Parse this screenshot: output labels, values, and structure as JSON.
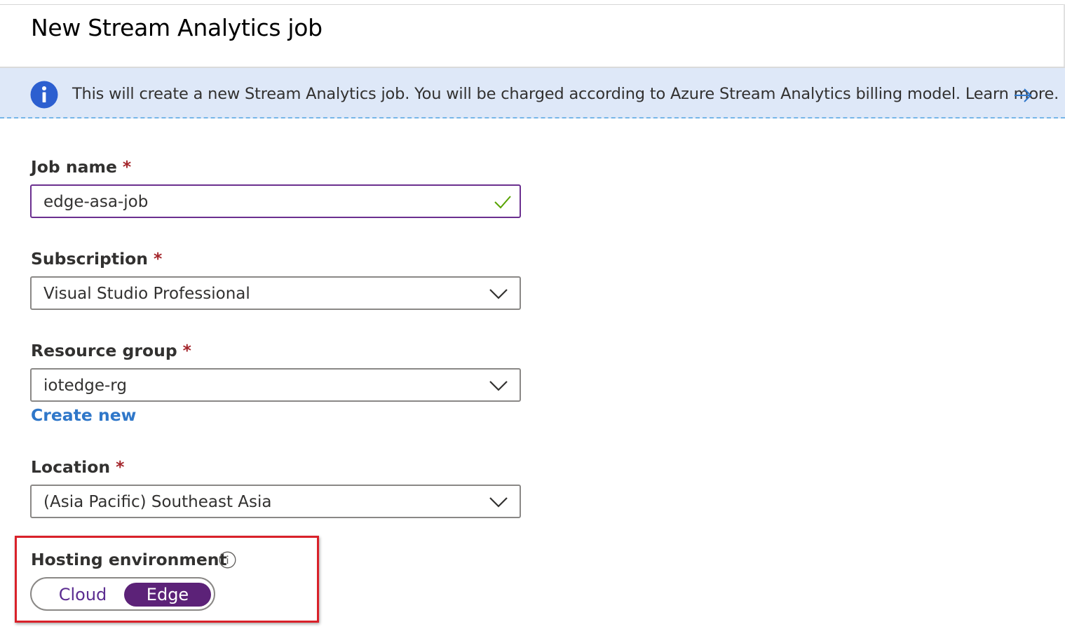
{
  "page": {
    "title": "New Stream Analytics job"
  },
  "banner": {
    "text": "This will create a new Stream Analytics job. You will be charged according to Azure Stream Analytics billing model. Learn more.",
    "icon": "info-icon",
    "link_icon": "arrow-right-icon"
  },
  "form": {
    "required_marker": "*",
    "job_name": {
      "label": "Job name",
      "value": "edge-asa-job",
      "valid": true
    },
    "subscription": {
      "label": "Subscription",
      "value": "Visual Studio Professional"
    },
    "resource_group": {
      "label": "Resource group",
      "value": "iotedge-rg",
      "create_new_label": "Create new"
    },
    "location": {
      "label": "Location",
      "value": "(Asia Pacific) Southeast Asia"
    },
    "hosting_environment": {
      "label": "Hosting environment",
      "options": [
        "Cloud",
        "Edge"
      ],
      "selected": "Edge"
    }
  },
  "colors": {
    "accent_purple": "#5c2278",
    "link_blue": "#2f77c9",
    "required_red": "#a4262c",
    "highlight_red": "#d9212a",
    "banner_bg": "#dee8f8",
    "valid_green": "#57a300"
  }
}
